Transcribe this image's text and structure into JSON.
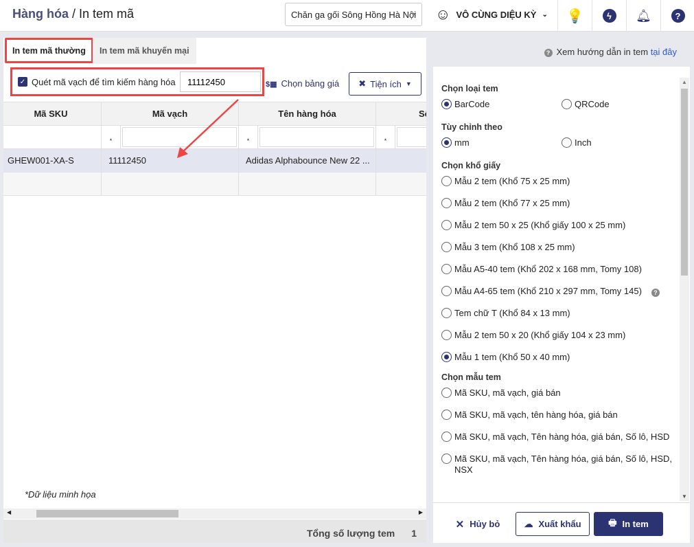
{
  "header": {
    "section": "Hàng hóa",
    "sep": " / ",
    "page": "In tem mã",
    "store": "Chăn ga gối Sông Hồng Hà Nội",
    "user": "VÔ CÙNG DIỆU KỲ"
  },
  "tabs": [
    "In tem mã thường",
    "In tem mã khuyến mại"
  ],
  "guide": {
    "text": "Xem hướng dẫn in tem ",
    "link": "tại đây"
  },
  "toolbar": {
    "scan_label": "Quét mã vạch để tìm kiếm hàng hóa",
    "scan_value": "11112450",
    "price_label": "Chọn bảng giá",
    "util_label": "Tiện ích"
  },
  "table": {
    "columns": [
      "Mã SKU",
      "Mã vạch",
      "Tên hàng hóa",
      "Số"
    ],
    "filter_op": "*",
    "rows": [
      [
        "GHEW001-XA-S",
        "11112450",
        "Adidas Alphabounce New 22 ...",
        ""
      ]
    ]
  },
  "note": "*Dữ liệu minh họa",
  "footer": {
    "total_label": "Tổng số lượng tem",
    "total_value": "1"
  },
  "options": {
    "type_title": "Chọn loại tem",
    "types": [
      "BarCode",
      "QRCode"
    ],
    "type_sel": 0,
    "unit_title": "Tùy chỉnh theo",
    "units": [
      "mm",
      "Inch"
    ],
    "unit_sel": 0,
    "paper_title": "Chọn khổ giấy",
    "papers": [
      "Mẫu 2 tem (Khổ 75 x 25 mm)",
      "Mẫu 2 tem (Khổ 77 x 25 mm)",
      "Mẫu 2 tem 50 x 25 (Khổ giấy 100 x 25 mm)",
      "Mẫu 3 tem (Khổ 108 x 25 mm)",
      "Mẫu A5-40 tem (Khổ 202 x 168 mm, Tomy 108)",
      "Mẫu A4-65 tem (Khổ 210 x 297 mm, Tomy 145)",
      "Tem chữ T (Khổ 84 x 13 mm)",
      "Mẫu 2 tem 50 x 20 (Khổ giấy 104 x 23 mm)",
      "Mẫu 1 tem (Khổ 50 x 40 mm)"
    ],
    "paper_sel": 8,
    "template_title": "Chọn mẫu tem",
    "templates": [
      "Mã SKU, mã vạch, giá bán",
      "Mã SKU, mã vạch, tên hàng hóa, giá bán",
      "Mã SKU, mã vạch, Tên hàng hóa, giá bán, Số lô, HSD",
      "Mã SKU, mã vạch, Tên hàng hóa, giá bán, Số lô, HSD, NSX"
    ]
  },
  "actions": {
    "cancel": "Hủy bỏ",
    "export": "Xuất khẩu",
    "print": "In tem"
  },
  "colors": {
    "primary": "#2c3373",
    "highlight": "#ef4444"
  }
}
